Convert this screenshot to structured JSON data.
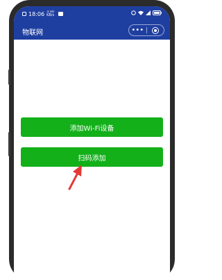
{
  "status_bar": {
    "time": "18:06",
    "speed": "3.00 KB/s",
    "battery_icon": "battery-icon",
    "signal_icon": "signal-icon",
    "wifi_icon": "wifi-icon"
  },
  "nav": {
    "title": "物联网",
    "more_label": "•••"
  },
  "buttons": {
    "add_wifi_device": "添加Wi-Fi设备",
    "scan_add": "扫码添加"
  },
  "colors": {
    "header": "#1f3fa0",
    "button": "#13b01a",
    "annotation_arrow": "#e53935"
  }
}
